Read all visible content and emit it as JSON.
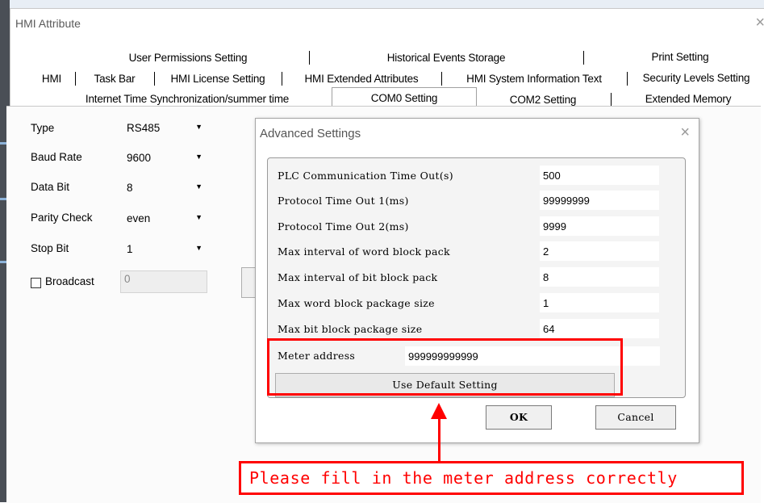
{
  "window": {
    "title": "HMI Attribute",
    "close_glyph": "×"
  },
  "tabs": {
    "row1": [
      "User Permissions Setting",
      "Historical Events Storage",
      "Print Setting"
    ],
    "row2": [
      "HMI",
      "Task Bar",
      "HMI License Setting",
      "HMI Extended Attributes",
      "HMI System Information Text",
      "Security Levels Setting"
    ],
    "row3": [
      "Internet Time Synchronization/summer time",
      "COM0 Setting",
      "COM2 Setting",
      "Extended Memory"
    ],
    "active": "COM0 Setting"
  },
  "com_form": {
    "type_label": "Type",
    "type_value": "RS485",
    "baud_label": "Baud Rate",
    "baud_value": "9600",
    "databit_label": "Data Bit",
    "databit_value": "8",
    "parity_label": "Parity Check",
    "parity_value": "even",
    "stopbit_label": "Stop Bit",
    "stopbit_value": "1",
    "broadcast_label": "Broadcast",
    "broadcast_checked": false,
    "broadcast_value": "0"
  },
  "dialog": {
    "title": "Advanced Settings",
    "close_glyph": "×",
    "params": [
      {
        "label": "PLC Communication Time Out(s)",
        "value": "500"
      },
      {
        "label": "Protocol Time Out 1(ms)",
        "value": "99999999"
      },
      {
        "label": "Protocol Time Out 2(ms)",
        "value": "9999"
      },
      {
        "label": "Max interval of word block pack",
        "value": "2"
      },
      {
        "label": "Max interval of bit block pack",
        "value": "8"
      },
      {
        "label": "Max word block package size",
        "value": "1"
      },
      {
        "label": "Max bit block package size",
        "value": "64"
      }
    ],
    "meter_label": "Meter address",
    "meter_value": "999999999999",
    "default_button": "Use Default Setting",
    "ok_button": "OK",
    "cancel_button": "Cancel"
  },
  "annotation": {
    "note": "Please fill in the meter address correctly",
    "color": "#ff0000"
  }
}
